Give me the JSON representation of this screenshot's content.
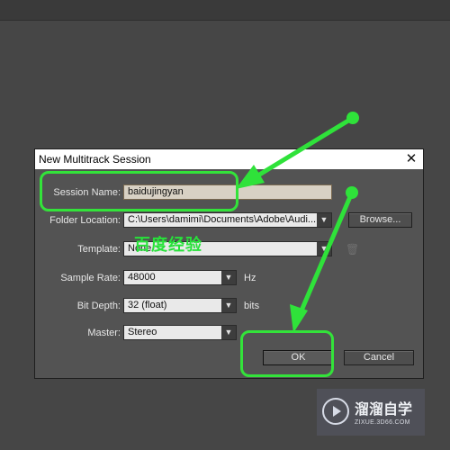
{
  "dialog": {
    "title": "New Multitrack Session",
    "close_glyph": "✕",
    "session_name": {
      "label": "Session Name:",
      "value": "baidujingyan"
    },
    "folder_location": {
      "label": "Folder Location:",
      "value": "C:\\Users\\damimi\\Documents\\Adobe\\Audi...",
      "browse_label": "Browse..."
    },
    "template": {
      "label": "Template:",
      "value": "None"
    },
    "sample_rate": {
      "label": "Sample Rate:",
      "value": "48000",
      "unit": "Hz"
    },
    "bit_depth": {
      "label": "Bit Depth:",
      "value": "32 (float)",
      "unit": "bits"
    },
    "master": {
      "label": "Master:",
      "value": "Stereo"
    },
    "ok_label": "OK",
    "cancel_label": "Cancel"
  },
  "icons": {
    "dropdown": "chevron-down-icon",
    "trash": "trash-icon",
    "close": "close-icon"
  },
  "overlay": {
    "caption": "百度经验",
    "color": "#27e23a"
  },
  "watermark": {
    "title": "溜溜自学",
    "url": "ZIXUE.3D66.COM"
  }
}
